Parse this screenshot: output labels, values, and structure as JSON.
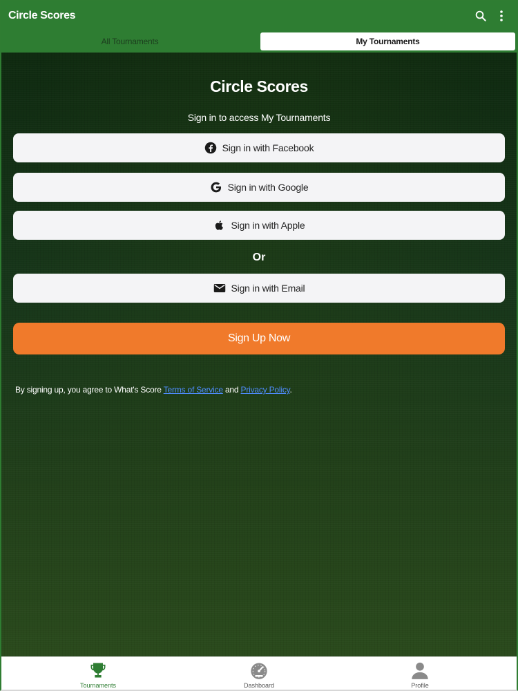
{
  "app": {
    "title": "Circle Scores"
  },
  "header_icons": {
    "search": "search-icon",
    "more": "more-vertical-icon"
  },
  "tabs": [
    {
      "label": "All Tournaments",
      "active": false
    },
    {
      "label": "My Tournaments",
      "active": true
    }
  ],
  "main": {
    "heading": "Circle Scores",
    "subheading": "Sign in to access My Tournaments",
    "buttons": {
      "facebook": "Sign in with Facebook",
      "google": "Sign in with Google",
      "apple": "Sign in with Apple",
      "email": "Sign in with Email"
    },
    "or": "Or",
    "signup": "Sign Up Now",
    "terms": {
      "prefix": "By signing up, you agree to What's Score ",
      "tos": "Terms of Service",
      "middle": " and ",
      "privacy": "Privacy Policy",
      "suffix": "."
    }
  },
  "bottom_nav": [
    {
      "label": "Tournaments",
      "icon": "trophy-icon",
      "active": true
    },
    {
      "label": "Dashboard",
      "icon": "speedometer-icon",
      "active": false
    },
    {
      "label": "Profile",
      "icon": "person-icon",
      "active": false
    }
  ],
  "colors": {
    "primary_green": "#2e7d32",
    "accent_orange": "#f07a2b",
    "link_blue": "#4f8dff",
    "button_bg": "#f4f4f6"
  }
}
